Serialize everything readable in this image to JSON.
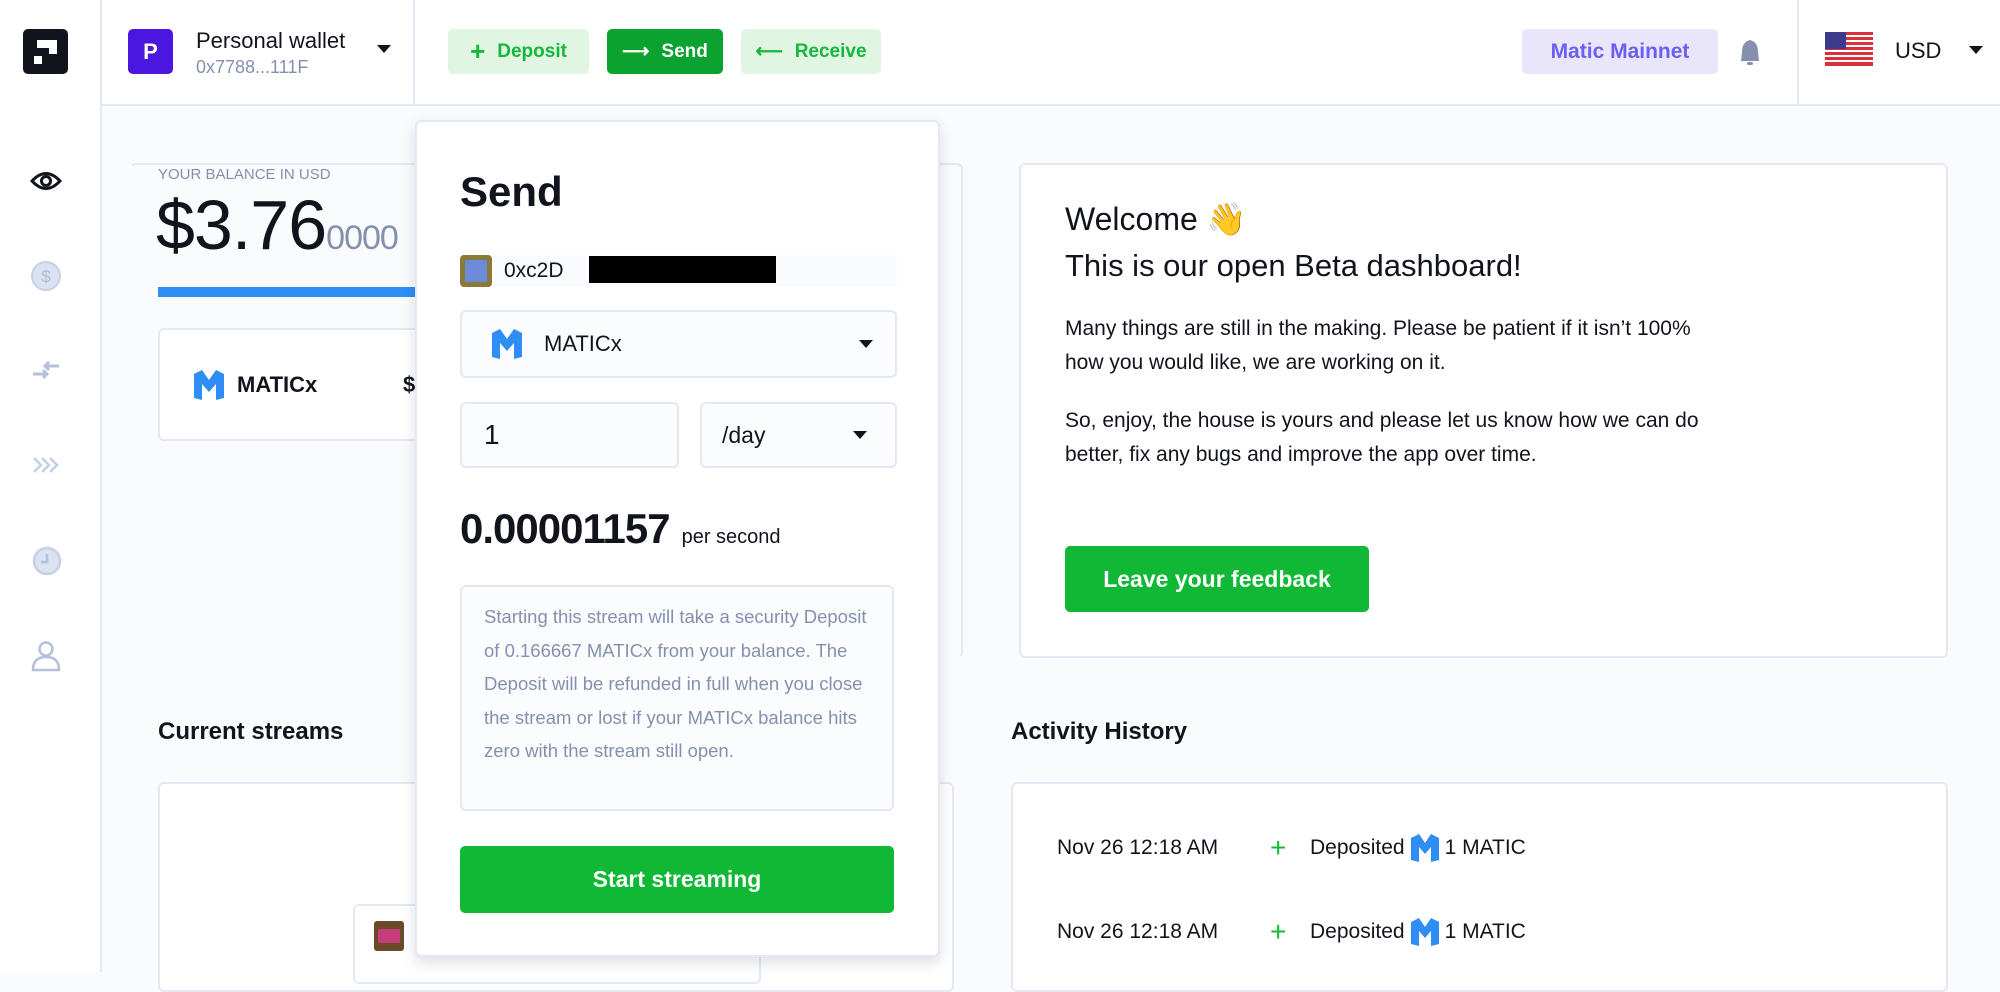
{
  "wallet": {
    "avatar_letter": "P",
    "name": "Personal wallet",
    "address": "0x7788...111F"
  },
  "actions": {
    "deposit": "Deposit",
    "send": "Send",
    "receive": "Receive"
  },
  "network": "Matic Mainnet",
  "currency": "USD",
  "sidebar": {
    "items": [
      {
        "icon": "eye-icon",
        "active": true
      },
      {
        "icon": "dollar-icon"
      },
      {
        "icon": "transfer-icon"
      },
      {
        "icon": "stream-icon"
      },
      {
        "icon": "history-icon"
      },
      {
        "icon": "user-icon"
      }
    ]
  },
  "balance": {
    "label": "YOUR BALANCE IN USD",
    "main": "$3.76",
    "decimals": "0000",
    "token": "MATICx",
    "token_value": "$"
  },
  "streams": {
    "heading": "Current streams"
  },
  "send_panel": {
    "title": "Send",
    "recipient": "0xc2D",
    "token": "MATICx",
    "amount": "1",
    "period": "/day",
    "rate": "0.00001157",
    "rate_unit": "per second",
    "notice": "Starting this stream will take a security Deposit of 0.166667 MATICx from your balance. The Deposit will be refunded in full when you close the stream or lost if your MATICx balance hits zero with the stream still open.",
    "submit": "Start streaming"
  },
  "welcome": {
    "title": "Welcome",
    "emoji": "👋",
    "subtitle": "This is our open Beta dashboard!",
    "p1": "Many things are still in the making. Please be patient if it isn’t 100% how you would like, we are working on it.",
    "p2": "So, enjoy, the house is yours and please let us know how we can do better, fix any bugs and improve the app over time.",
    "button": "Leave your feedback"
  },
  "activity": {
    "heading": "Activity History",
    "rows": [
      {
        "date": "Nov 26 12:18 AM",
        "sign": "+",
        "action": "Deposited",
        "amount": "1 MATIC"
      },
      {
        "date": "Nov 26 12:18 AM",
        "sign": "+",
        "action": "Deposited",
        "amount": "1 MATIC"
      }
    ]
  },
  "colors": {
    "green": "#10b836",
    "send_green": "#0ba22f",
    "purple": "#4a16e0",
    "network_bg": "#e9e6fc",
    "network_text": "#6b5ef0",
    "balance_bar": "#2f8ef5"
  }
}
